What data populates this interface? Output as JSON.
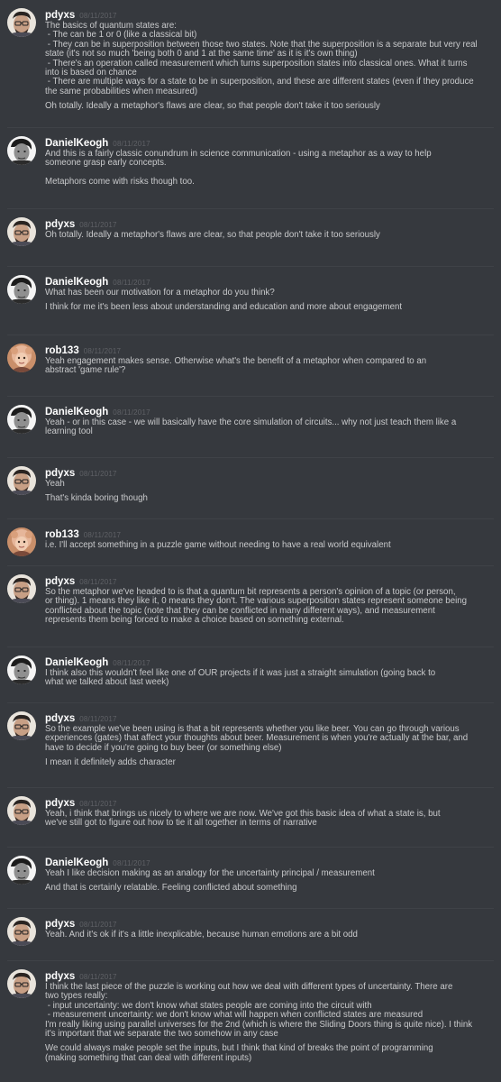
{
  "colors": {
    "background": "#36393e",
    "username": "#ffffff",
    "text": "#c9cacc",
    "timestamp": "#5f6166"
  },
  "messages": [
    {
      "user": "pdyxs",
      "avatar": "pdyxs-avatar",
      "time": "08/11/2017",
      "lines": [
        "The basics of quantum states are:",
        " - The can be 1 or 0 (like a classical bit)",
        " - They can be in superposition between those two states. Note that the superposition is a separate but very real",
        "state (it's not so much 'being both 0 and 1 at the same time' as it is it's own thing)",
        " - There's an operation called measurement which turns superposition states into classical ones. What it turns",
        "into is based on chance",
        " - There are multiple ways for a state to be in superposition, and these are different states (even if they produce",
        "the same probabilities when measured)"
      ],
      "extra": [
        "Oh totally. Ideally a metaphor's flaws are clear, so that people don't take it too seriously"
      ]
    },
    {
      "user": "DanielKeogh",
      "avatar": "danielkeogh-avatar",
      "time": "08/11/2017",
      "lines": [
        "And this is a fairly classic conundrum in science communication - using a metaphor as a way to help",
        "someone grasp early concepts."
      ],
      "extra": [
        "Metaphors come with risks though too."
      ]
    },
    {
      "user": "pdyxs",
      "avatar": "pdyxs-avatar",
      "time": "08/11/2017",
      "lines": [
        "Oh totally. Ideally a metaphor's flaws are clear, so that people don't take it too seriously"
      ],
      "extra": []
    },
    {
      "user": "DanielKeogh",
      "avatar": "danielkeogh-avatar",
      "time": "08/11/2017",
      "lines": [
        "What has been our motivation for a metaphor do you think?"
      ],
      "extra": [
        "I think for me it's been less about understanding and education and more about engagement"
      ]
    },
    {
      "user": "rob133",
      "avatar": "rob133-avatar",
      "time": "08/11/2017",
      "lines": [
        "Yeah engagement makes sense. Otherwise what's the benefit of a metaphor when compared to an",
        "abstract 'game rule'?"
      ],
      "extra": []
    },
    {
      "user": "DanielKeogh",
      "avatar": "danielkeogh-avatar",
      "time": "08/11/2017",
      "lines": [
        "Yeah - or in this case - we will basically have the core simulation of circuits... why not just teach them like a",
        "learning tool"
      ],
      "extra": []
    },
    {
      "user": "pdyxs",
      "avatar": "pdyxs-avatar",
      "time": "08/11/2017",
      "lines": [
        "Yeah"
      ],
      "extra": [
        "That's kinda boring though"
      ]
    },
    {
      "user": "rob133",
      "avatar": "rob133-avatar",
      "time": "08/11/2017",
      "lines": [
        "i.e. I'll accept something in a puzzle game without needing to have a real world equivalent"
      ],
      "extra": []
    },
    {
      "user": "pdyxs",
      "avatar": "pdyxs-avatar",
      "time": "08/11/2017",
      "lines": [
        "So the metaphor we've headed to is that a quantum bit represents a person's opinion of a topic (or person,",
        "or thing). 1 means they like it, 0 means they don't. The various superposition states represent someone being",
        "conflicted about the topic (note that they can be conflicted in many different ways), and measurement",
        "represents them being forced to make a choice based on something external."
      ],
      "extra": []
    },
    {
      "user": "DanielKeogh",
      "avatar": "danielkeogh-avatar",
      "time": "08/11/2017",
      "lines": [
        "I think also this wouldn't feel like one of OUR projects if it was just a straight simulation (going back to",
        "what we talked about last week)"
      ],
      "extra": []
    },
    {
      "user": "pdyxs",
      "avatar": "pdyxs-avatar",
      "time": "08/11/2017",
      "lines": [
        "So the example we've been using is that a bit represents whether you like beer. You can go through various",
        "experiences (gates) that affect your thoughts about beer. Measurement is when you're actually at the bar, and",
        "have to decide if you're going to buy beer (or something else)"
      ],
      "extra": [
        "I mean it definitely adds character"
      ]
    },
    {
      "user": "pdyxs",
      "avatar": "pdyxs-avatar",
      "time": "08/11/2017",
      "lines": [
        "Yeah, i think that brings us nicely to where we are now. We've got this basic idea of what a state is, but",
        "we've still got to figure out how to tie it all together in terms of narrative"
      ],
      "extra": []
    },
    {
      "user": "DanielKeogh",
      "avatar": "danielkeogh-avatar",
      "time": "08/11/2017",
      "lines": [
        "Yeah I like decision making as an analogy for the uncertainty principal / measurement"
      ],
      "extra": [
        "And that is certainly relatable. Feeling conflicted about something"
      ]
    },
    {
      "user": "pdyxs",
      "avatar": "pdyxs-avatar",
      "time": "08/11/2017",
      "lines": [
        "Yeah. And it's ok if it's a little inexplicable, because human emotions are a bit odd"
      ],
      "extra": []
    },
    {
      "user": "pdyxs",
      "avatar": "pdyxs-avatar",
      "time": "08/11/2017",
      "lines": [
        "I think the last piece of the puzzle is working out how we deal with different types of uncertainty. There are",
        "two types really:",
        " - input uncertainty: we don't know what states people are coming into the circuit with",
        " - measurement uncertainty: we don't know what will happen when conflicted states are measured",
        "I'm really liking using parallel universes for the 2nd (which is where the Sliding Doors thing is quite nice). I think",
        "it's important that we separate the two somehow in any case"
      ],
      "extra": [
        "We could always make people set the inputs, but I think that kind of breaks the point of programming",
        "(making something that can deal with different inputs)"
      ]
    }
  ]
}
